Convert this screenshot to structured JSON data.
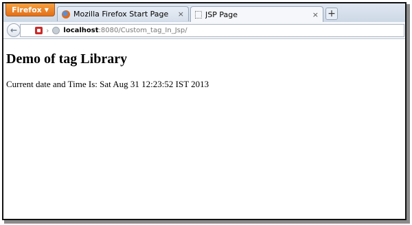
{
  "browser": {
    "menu_label": "Firefox",
    "menu_caret": "▼",
    "tabs": [
      {
        "title": "Mozilla Firefox Start Page",
        "icon": "firefox-icon",
        "active": false
      },
      {
        "title": "JSP Page",
        "icon": "blank-page-icon",
        "active": true
      }
    ],
    "tab_close_glyph": "×",
    "new_tab_glyph": "+",
    "back_glyph": "←",
    "url_host": "localhost",
    "url_rest": ":8080/Custom_tag_In_Jsp/"
  },
  "page": {
    "heading": "Demo of tag Library",
    "datetime_text": "Current date and Time Is: Sat Aug 31 12:23:52 IST 2013"
  }
}
